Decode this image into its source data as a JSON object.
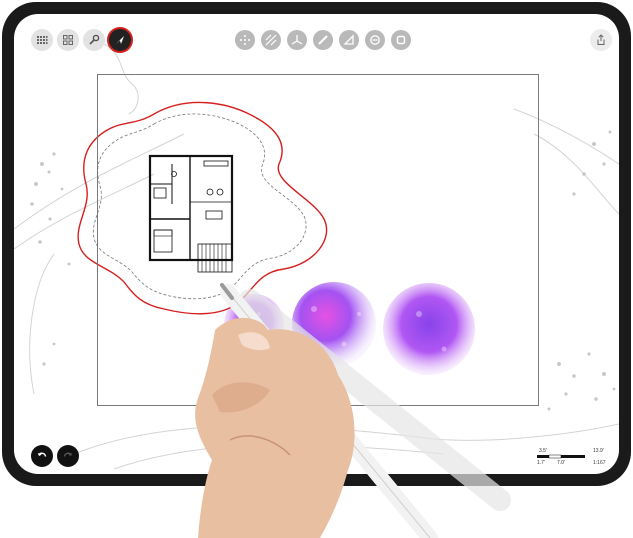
{
  "toolbar": {
    "left": [
      {
        "name": "layers-grid-icon"
      },
      {
        "name": "gallery-icon"
      },
      {
        "name": "wrench-icon"
      },
      {
        "name": "pointer-icon",
        "active": true
      }
    ],
    "center": [
      {
        "name": "select-dots-icon"
      },
      {
        "name": "hatch-icon"
      },
      {
        "name": "angle-icon"
      },
      {
        "name": "pen-icon"
      },
      {
        "name": "ruler-triangle-icon"
      },
      {
        "name": "circle-minus-icon"
      },
      {
        "name": "square-icon"
      }
    ],
    "right": [
      {
        "name": "share-icon"
      }
    ]
  },
  "bottom_controls": [
    {
      "name": "undo-icon"
    },
    {
      "name": "redo-icon"
    }
  ],
  "scale_bar": {
    "top_left": "3.5'",
    "top_right": "13.9'",
    "bottom_left": "1.7'",
    "bottom_mid": "7.0'",
    "ratio": "1:167"
  },
  "colors": {
    "accent_red": "#d62020",
    "bezel": "#1a1a1a",
    "tree_purple": "#9b3ff0",
    "tree_pink": "#e23ee0"
  }
}
